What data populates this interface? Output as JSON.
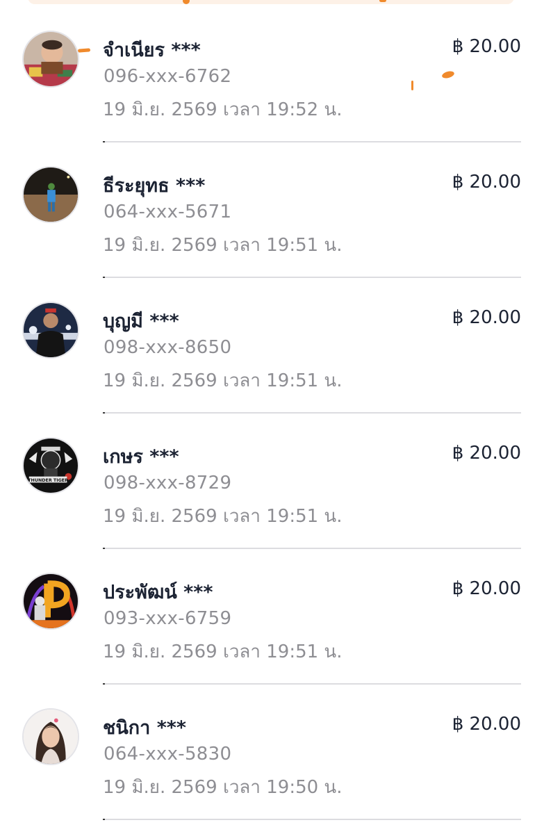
{
  "currency_symbol": "฿",
  "colors": {
    "name_text": "#1c2333",
    "secondary_text": "#8e8e93",
    "divider": "#dcdce0",
    "accent": "#f08a2c"
  },
  "transactions": [
    {
      "name": "จำเนียร ***",
      "phone": "096-xxx-6762",
      "datetime": "19 มิ.ย. 2569 เวลา 19:52 น.",
      "amount": "฿ 20.00",
      "avatar": "baby-photo-avatar"
    },
    {
      "name": "ธีระยุทธ ***",
      "phone": "064-xxx-5671",
      "datetime": "19 มิ.ย. 2569 เวลา 19:51 น.",
      "amount": "฿ 20.00",
      "avatar": "night-field-photo-avatar"
    },
    {
      "name": "บุญมี ***",
      "phone": "098-xxx-8650",
      "datetime": "19 มิ.ย. 2569 เวลา 19:51 น.",
      "amount": "฿ 20.00",
      "avatar": "man-portrait-avatar"
    },
    {
      "name": "เกษร ***",
      "phone": "098-xxx-8729",
      "datetime": "19 มิ.ย. 2569 เวลา 19:51 น.",
      "amount": "฿ 20.00",
      "avatar": "thunder-tiger-logo-avatar",
      "avatar_text": "THUNDER TIGER"
    },
    {
      "name": "ประพัฒน์ ***",
      "phone": "093-xxx-6759",
      "datetime": "19 มิ.ย. 2569 เวลา 19:51 น.",
      "amount": "฿ 20.00",
      "avatar": "letter-p-dragon-avatar"
    },
    {
      "name": "ชนิกา ***",
      "phone": "064-xxx-5830",
      "datetime": "19 มิ.ย. 2569 เวลา 19:50 น.",
      "amount": "฿ 20.00",
      "avatar": "woman-portrait-avatar"
    }
  ]
}
